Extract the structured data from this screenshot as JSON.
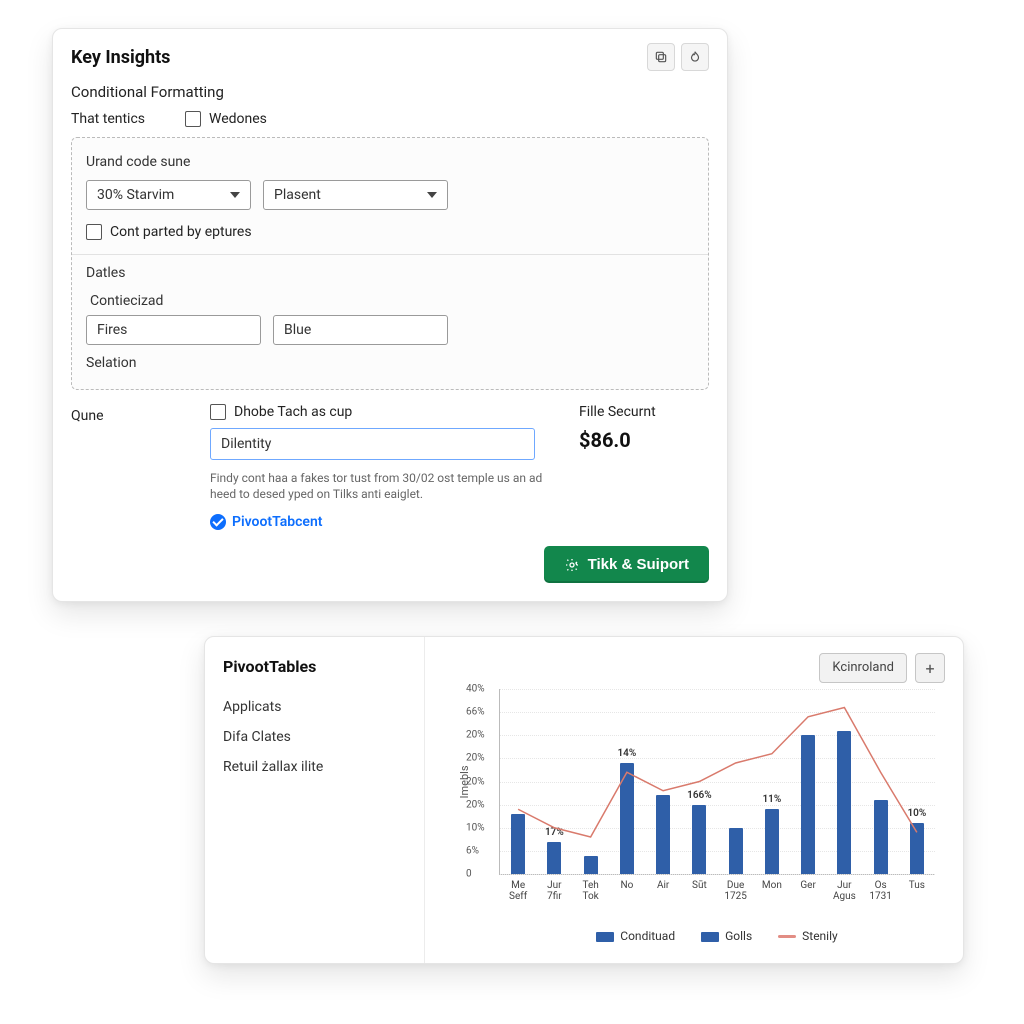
{
  "panel1": {
    "title": "Key Insights",
    "icon1": "copy-icon",
    "icon2": "flame-icon",
    "subhead": "Conditional Formatting",
    "option_a_label": "That tentics",
    "option_b_label": "Wedones",
    "fieldset": {
      "label": "Urand code sune",
      "select1": "30% Starvim",
      "select2": "Plasent",
      "checkbox_label": "Cont parted by eptures",
      "section_dates": "Datles",
      "subsection_label": "Contiecizad",
      "input1_value": "Fires",
      "input2_value": "Blue",
      "section_selation": "Selation"
    },
    "bottom": {
      "left_label": "Qune",
      "checkbox_label": "Dhobe Tach as cup",
      "field_value": "Dilentity",
      "help1": "Findy cont haa a fakes tor tust from 30/02 ost temple us an ad heed to desed yped on Tilks anti eaiglet.",
      "link_label": "PivootTabcent"
    },
    "price": {
      "label": "Fille Securnt",
      "value": "$86.0"
    },
    "button_label": "Tikk & Suiport"
  },
  "panel2": {
    "title": "PivootTables",
    "items": [
      "Applicats",
      "Difa Clates",
      "Retuil żallax ilite"
    ],
    "header_button": "Kcinroland"
  },
  "chart_data": {
    "type": "bar+line",
    "ylabel": "Imebls",
    "ylim": [
      0,
      40
    ],
    "yticks": [
      "40%",
      "66%",
      "20%",
      "20%",
      "20%",
      "20%",
      "10%",
      "6%",
      "0"
    ],
    "categories": [
      [
        "Me",
        "Seff"
      ],
      [
        "Jur",
        "7fir"
      ],
      [
        "Teh",
        "Tok"
      ],
      [
        "No",
        ""
      ],
      [
        "Air",
        ""
      ],
      [
        "Sūt",
        ""
      ],
      [
        "Due",
        "1725"
      ],
      [
        "Mon",
        ""
      ],
      [
        "Ger",
        ""
      ],
      [
        "Jur",
        "Agus"
      ],
      [
        "Os",
        "1731"
      ],
      [
        "Tus",
        ""
      ]
    ],
    "bar_values": [
      13,
      7,
      4,
      24,
      17,
      15,
      10,
      14,
      30,
      31,
      16,
      11
    ],
    "bar_labels": [
      "",
      "17%",
      "",
      "14%",
      "",
      "166%",
      "",
      "11%",
      "",
      "",
      "",
      "10%"
    ],
    "line_values": [
      14,
      10,
      8,
      22,
      18,
      20,
      24,
      26,
      34,
      36,
      22,
      9
    ],
    "legend": [
      {
        "swatch": "#2f5fa8",
        "label": "Condituad"
      },
      {
        "swatch": "#2f5fa8",
        "label": "Golls"
      },
      {
        "swatch": "#e28d84",
        "label": "Stenily"
      }
    ]
  }
}
